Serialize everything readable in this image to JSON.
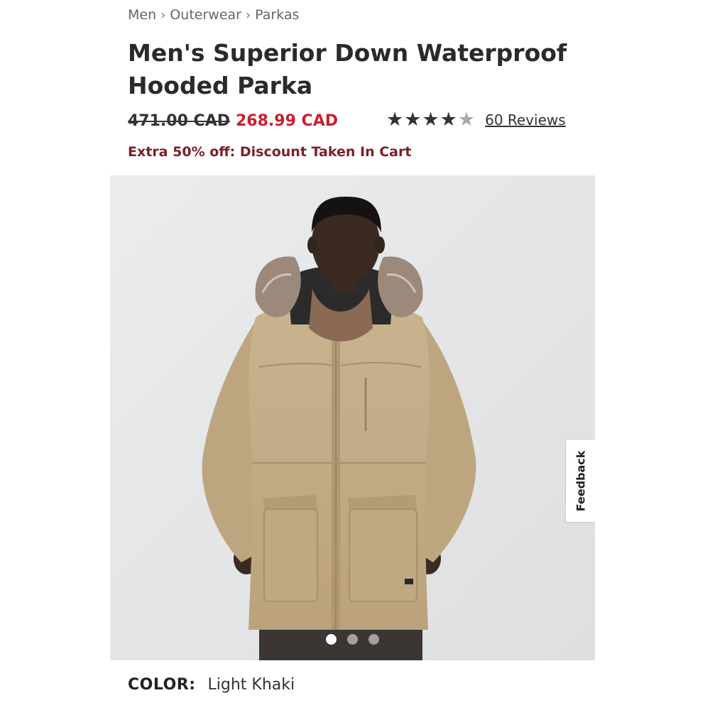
{
  "breadcrumb": {
    "items": [
      "Men",
      "Outerwear",
      "Parkas"
    ]
  },
  "product": {
    "title": "Men's Superior Down Waterproof Hooded Parka",
    "original_price": "471.00 CAD",
    "sale_price": "268.99 CAD",
    "rating": 4,
    "rating_max": 5,
    "reviews_label": "60 Reviews",
    "promo": "Extra 50% off: Discount Taken In Cart"
  },
  "gallery": {
    "image_alt_icon": "product-photo",
    "slide_count": 3,
    "active_slide": 1
  },
  "feedback": {
    "label": "Feedback"
  },
  "color": {
    "label": "COLOR:",
    "value": "Light Khaki"
  },
  "colors": {
    "sale": "#c8202f",
    "promo": "#7a1f28",
    "jacket": "#c4ad88"
  }
}
